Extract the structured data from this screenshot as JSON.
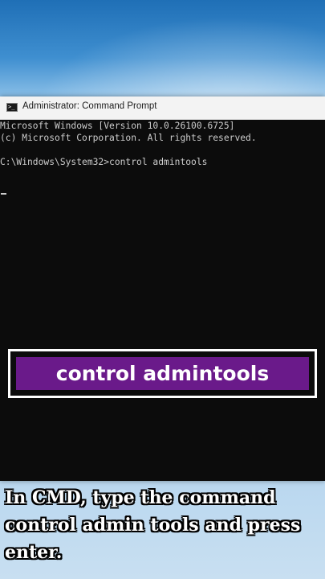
{
  "window": {
    "title": "Administrator: Command Prompt",
    "icon": "cmd-prompt-icon",
    "icon_glyph": ">_"
  },
  "console": {
    "lines": [
      "Microsoft Windows [Version 10.0.26100.6725]",
      "(c) Microsoft Corporation. All rights reserved.",
      "",
      "C:\\Windows\\System32>control admintools"
    ]
  },
  "callout": {
    "text": "control admintools",
    "color": "#6a1a8a"
  },
  "caption": {
    "lines": [
      "In CMD, type the command",
      "control admin tools and press",
      "enter."
    ]
  }
}
